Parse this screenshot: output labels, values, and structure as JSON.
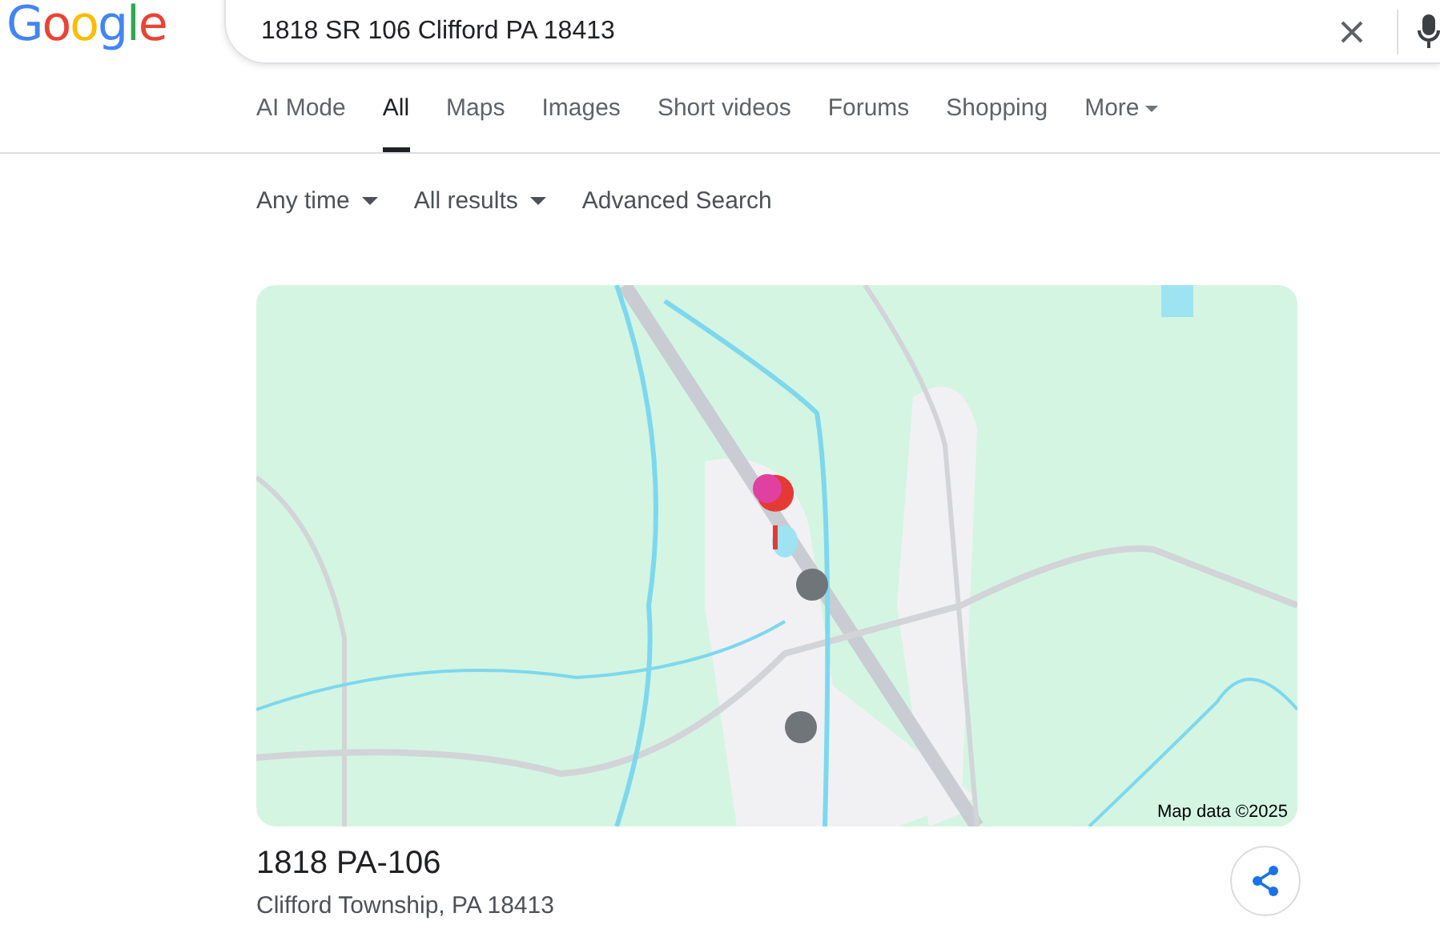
{
  "logo": "Google",
  "search": {
    "value": "1818 SR 106 Clifford PA 18413"
  },
  "tabs": [
    {
      "label": "AI Mode",
      "selected": false,
      "kind": "plain"
    },
    {
      "label": "All",
      "selected": true,
      "kind": "plain"
    },
    {
      "label": "Maps",
      "selected": false,
      "kind": "plain"
    },
    {
      "label": "Images",
      "selected": false,
      "kind": "plain"
    },
    {
      "label": "Short videos",
      "selected": false,
      "kind": "plain"
    },
    {
      "label": "Forums",
      "selected": false,
      "kind": "plain"
    },
    {
      "label": "Shopping",
      "selected": false,
      "kind": "plain"
    },
    {
      "label": "More",
      "selected": false,
      "kind": "menu"
    }
  ],
  "filters": [
    {
      "label": "Any time",
      "kind": "dropdown"
    },
    {
      "label": "All results",
      "kind": "dropdown"
    },
    {
      "label": "Advanced Search",
      "kind": "link"
    }
  ],
  "map": {
    "kind": "picture",
    "attribution": "Map data ©2025"
  },
  "place": {
    "title": "1818 PA-106",
    "address": "Clifford Township, PA 18413"
  }
}
